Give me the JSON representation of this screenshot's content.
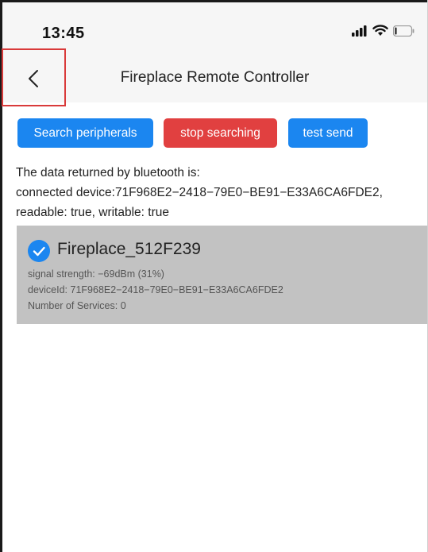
{
  "status_bar": {
    "time": "13:45",
    "icons": [
      "signal-icon",
      "wifi-icon",
      "battery-icon"
    ]
  },
  "nav": {
    "back_icon": "chevron-left-icon",
    "title": "Fireplace Remote Controller"
  },
  "actions": {
    "search_label": "Search peripherals",
    "stop_label": "stop searching",
    "test_label": "test send"
  },
  "bluetooth": {
    "header": "The data returned by bluetooth is:",
    "connection": "connected device:71F968E2−2418−79E0−BE91−E33A6CA6FDE2,",
    "permissions": "readable: true, writable: true"
  },
  "device": {
    "name": "Fireplace_512F239",
    "signal": "signal strength: −69dBm (31%)",
    "device_id": "deviceId: 71F968E2−2418−79E0−BE91−E33A6CA6FDE2",
    "services": "Number of Services: 0",
    "selected": true
  },
  "colors": {
    "primary": "#1b86f0",
    "danger": "#e14040",
    "card_bg": "#c2c2c2",
    "check": "#1b86f0",
    "highlight": "#d93a3a"
  }
}
